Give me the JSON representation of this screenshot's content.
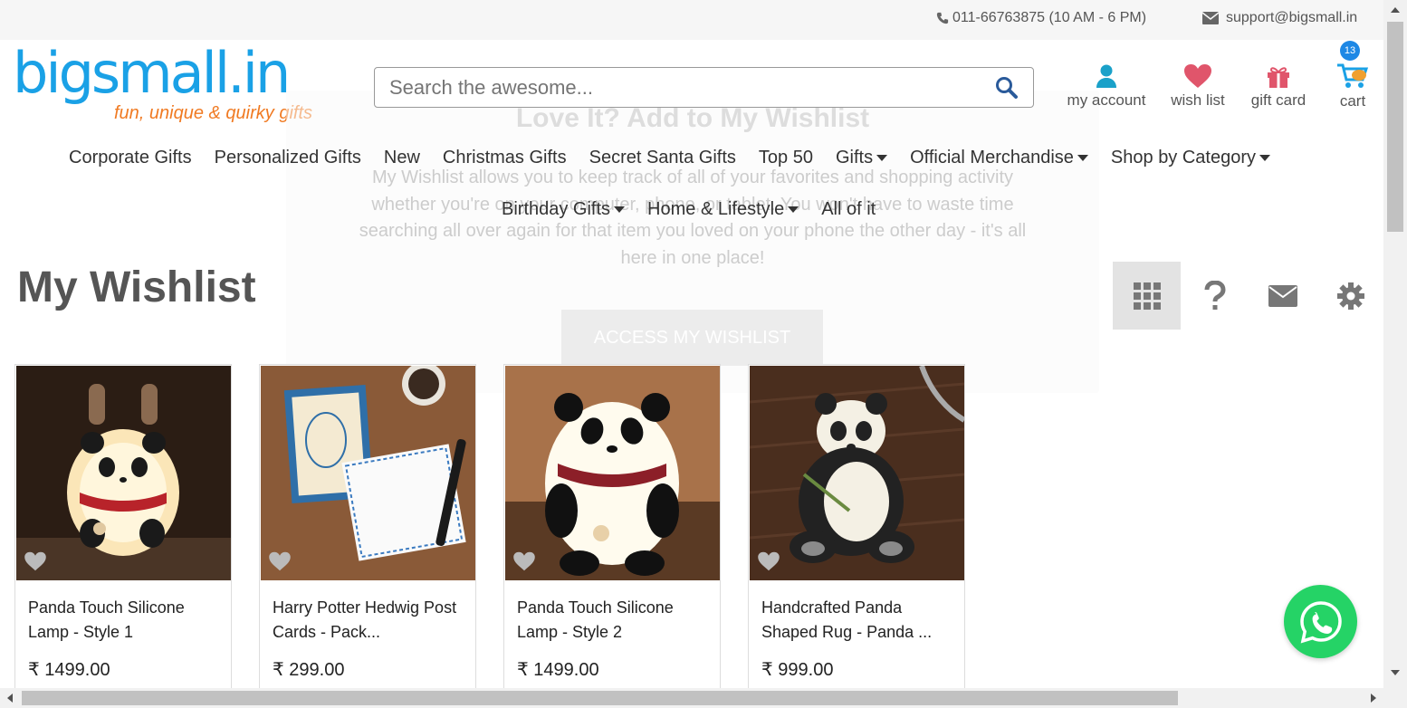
{
  "topbar": {
    "phone": "011-66763875 (10 AM - 6 PM)",
    "email": "support@bigsmall.in"
  },
  "logo": {
    "main": "bigsmall.in",
    "tagline": "fun, unique & quirky gifts"
  },
  "search": {
    "placeholder": "Search the awesome..."
  },
  "header_icons": {
    "account": "my account",
    "wishlist": "wish list",
    "giftcard": "gift card",
    "cart": "cart",
    "cart_count": "13"
  },
  "nav": {
    "row1": [
      {
        "label": "Corporate Gifts"
      },
      {
        "label": "Personalized Gifts"
      },
      {
        "label": "New"
      },
      {
        "label": "Christmas Gifts"
      },
      {
        "label": "Secret Santa Gifts"
      },
      {
        "label": "Top 50"
      },
      {
        "label": "Gifts"
      },
      {
        "label": "Official Merchandise"
      },
      {
        "label": "Shop by Category"
      }
    ],
    "row2": [
      {
        "label": "Birthday Gifts"
      },
      {
        "label": "Home & Lifestyle"
      },
      {
        "label": "All of it"
      }
    ]
  },
  "overlay": {
    "title": "Love It? Add to My Wishlist",
    "text": "My Wishlist allows you to keep track of all of your favorites and shopping activity whether you're on your computer, phone, or tablet. You won't have to waste time searching all over again for that item you loved on your phone the other day - it's all here in one place!",
    "button": "ACCESS MY WISHLIST"
  },
  "page_title": "My Wishlist",
  "products": [
    {
      "name": "Panda Touch Silicone Lamp - Style 1",
      "price": "₹ 1499.00"
    },
    {
      "name": "Harry Potter Hedwig Post Cards - Pack...",
      "price": "₹ 299.00"
    },
    {
      "name": "Panda Touch Silicone Lamp - Style 2",
      "price": "₹ 1499.00"
    },
    {
      "name": "Handcrafted Panda Shaped Rug - Panda ...",
      "price": "₹ 999.00"
    }
  ],
  "colors": {
    "brand_blue": "#1aa1e6",
    "brand_orange": "#f07a22",
    "whatsapp": "#25d366",
    "heart": "#e0556b"
  }
}
